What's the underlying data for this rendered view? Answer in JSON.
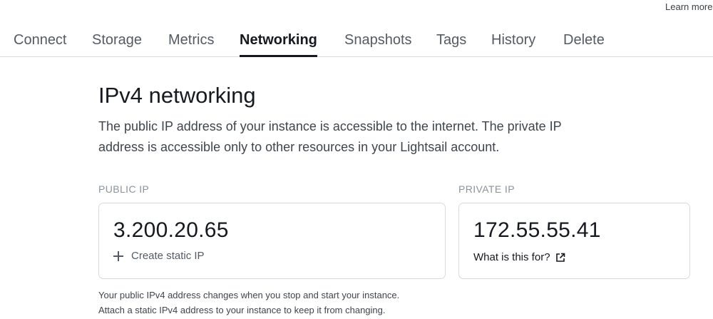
{
  "header": {
    "learn_more": "Learn more"
  },
  "tabs": [
    {
      "label": "Connect",
      "active": false
    },
    {
      "label": "Storage",
      "active": false
    },
    {
      "label": "Metrics",
      "active": false
    },
    {
      "label": "Networking",
      "active": true
    },
    {
      "label": "Snapshots",
      "active": false
    },
    {
      "label": "Tags",
      "active": false
    },
    {
      "label": "History",
      "active": false
    },
    {
      "label": "Delete",
      "active": false
    }
  ],
  "ipv4": {
    "title": "IPv4 networking",
    "description": "The public IP address of your instance is accessible to the internet. The private IP address is accessible only to other resources in your Lightsail account.",
    "public": {
      "label": "PUBLIC IP",
      "value": "3.200.20.65",
      "action": "Create static IP",
      "action_icon": "plus-icon",
      "helper_line1": "Your public IPv4 address changes when you stop and start your instance.",
      "helper_line2": "Attach a static IPv4 address to your instance to keep it from changing."
    },
    "private": {
      "label": "PRIVATE IP",
      "value": "172.55.55.41",
      "action": "What is this for?",
      "action_icon": "external-link-icon"
    }
  },
  "colors": {
    "text_dark": "#16191f",
    "text_muted": "#545b64",
    "label_gray": "#8a939c",
    "border": "#d5dbdb"
  }
}
